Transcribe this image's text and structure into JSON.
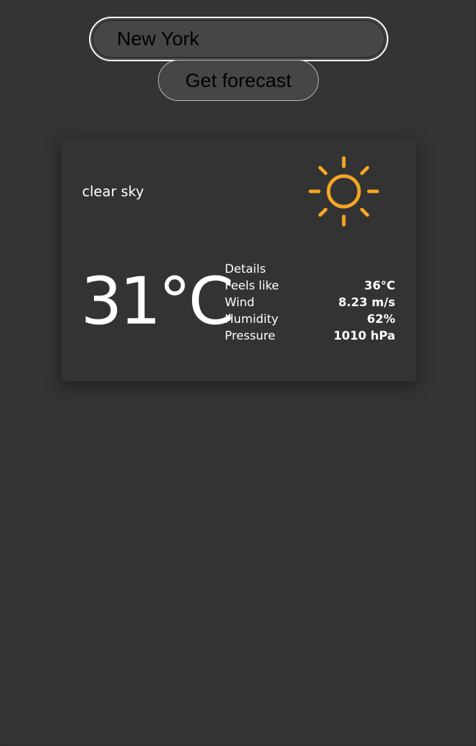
{
  "search": {
    "value": "New York"
  },
  "forecast_button": {
    "label": "Get forecast"
  },
  "weather": {
    "description": "clear sky",
    "icon": "sun-icon",
    "icon_color": "#f5a623",
    "temperature": "31°C",
    "details": {
      "title": "Details",
      "rows": [
        {
          "label": "Feels like",
          "value": "36°C"
        },
        {
          "label": "Wind",
          "value": "8.23 m/s"
        },
        {
          "label": "Humidity",
          "value": "62%"
        },
        {
          "label": "Pressure",
          "value": "1010 hPa"
        }
      ]
    }
  }
}
